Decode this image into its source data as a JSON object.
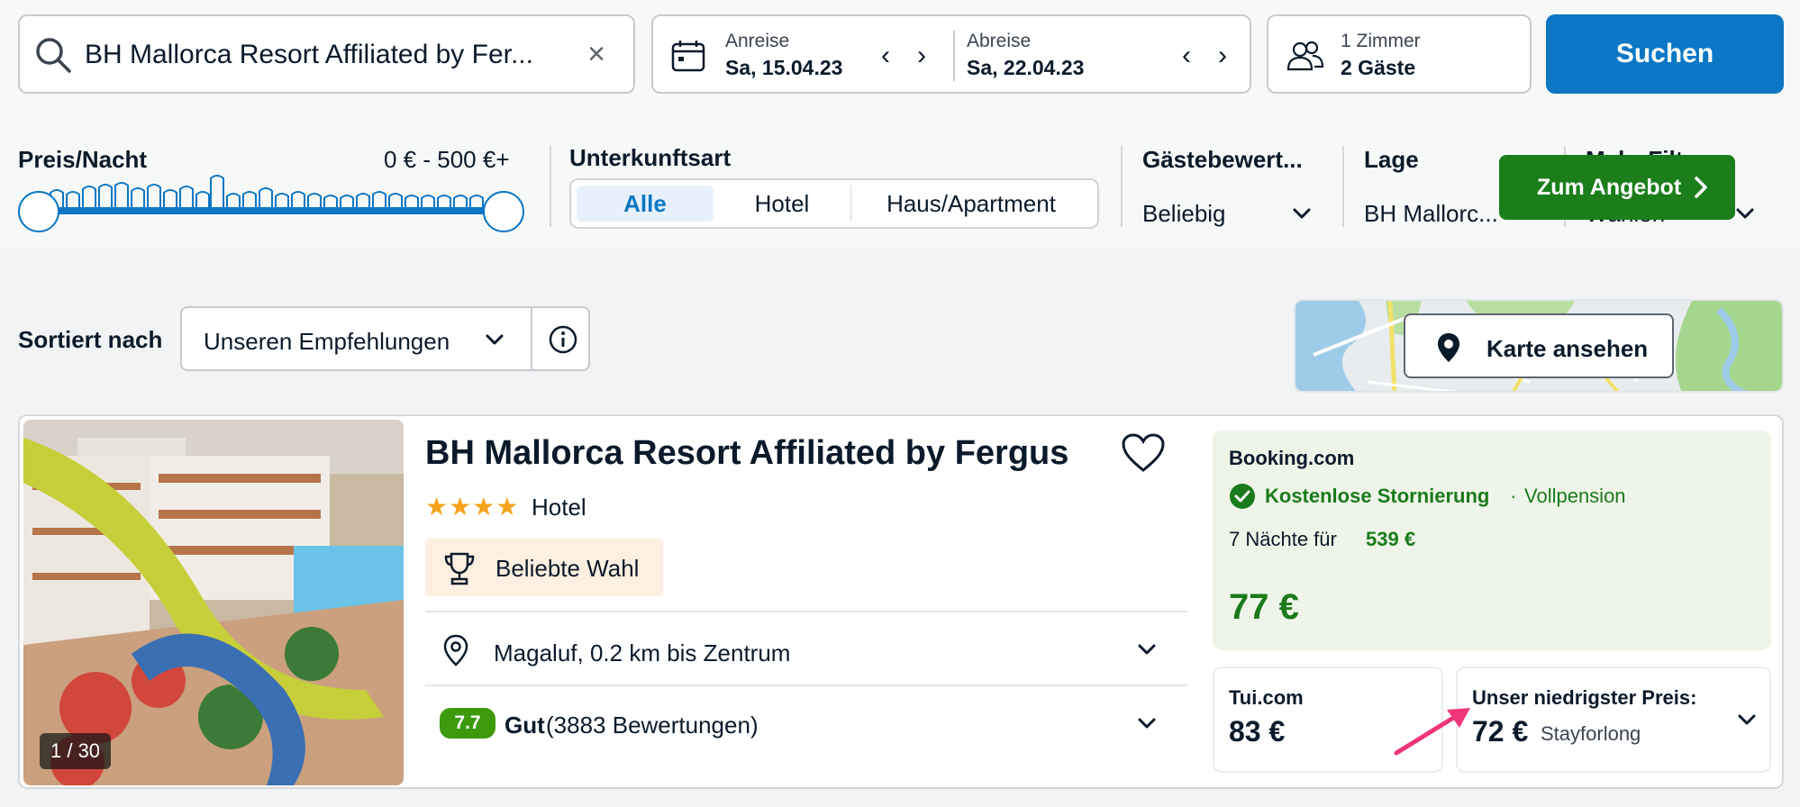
{
  "search": {
    "query": "BH Mallorca Resort Affiliated by Fer...",
    "clear_icon": "×"
  },
  "dates": {
    "checkin_label": "Anreise",
    "checkin_value": "Sa, 15.04.23",
    "checkout_label": "Abreise",
    "checkout_value": "Sa, 22.04.23"
  },
  "guests": {
    "rooms": "1 Zimmer",
    "guests": "2 Gäste"
  },
  "search_button": "Suchen",
  "filters": {
    "price_label": "Preis/Nacht",
    "price_range": "0 € - 500 €+",
    "type_label": "Unterkunftsart",
    "type_options": [
      "Alle",
      "Hotel",
      "Haus/Apartment"
    ],
    "type_selected": "Alle",
    "rating_label": "Gästebewert...",
    "rating_value": "Beliebig",
    "location_label": "Lage",
    "location_value": "BH Mallorc...",
    "more_label": "Mehr Filter",
    "more_value": "Wählen"
  },
  "sort": {
    "label": "Sortiert nach",
    "value": "Unseren Empfehlungen"
  },
  "map": {
    "button_label": "Karte ansehen"
  },
  "hotel": {
    "name": "BH Mallorca Resort Affiliated by Fergus",
    "stars": "★★★★",
    "star_count": 4,
    "type": "Hotel",
    "badge": "Beliebte Wahl",
    "location": "Magaluf, 0.2 km bis Zentrum",
    "rating_score": "7.7",
    "rating_word": "Gut",
    "rating_count": "(3883 Bewertungen)",
    "photo_counter": "1 / 30"
  },
  "offer": {
    "provider": "Booking.com",
    "cancellation": "Kostenlose Stornierung",
    "separator": "·",
    "board": "Vollpension",
    "nights_text": "7 Nächte für",
    "nights_price": "539 €",
    "price": "77 €",
    "button": "Zum Angebot"
  },
  "alternatives": [
    {
      "provider": "Tui.com",
      "price": "83 €"
    },
    {
      "provider": "Unser niedrigster Preis:",
      "price": "72 €",
      "vendor": "Stayforlong"
    }
  ],
  "colors": {
    "accent": "#0b77c5",
    "offer_green": "#1b7e1b",
    "rating_green": "#3d9a0c",
    "badge_bg": "#fdf0e0",
    "annotation_arrow": "#f0357a"
  }
}
